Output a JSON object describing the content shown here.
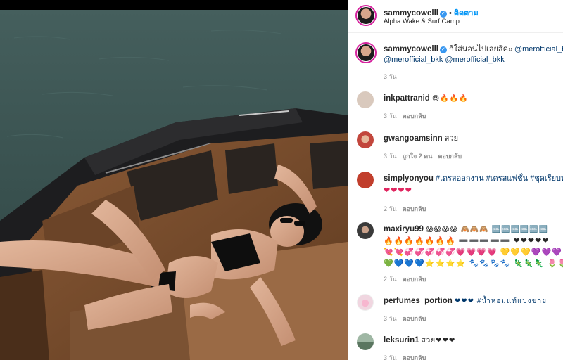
{
  "post": {
    "author": "sammycowelll",
    "follow_label": "ติดตาม",
    "dot": "•",
    "location": "Alpha Wake & Surf Camp",
    "caption_prefix": "กีใส่นอนไปเลยสิคะ",
    "caption_tags_line1": "@merofficial_bkk",
    "caption_tags_line2": "@merofficial_bkk @merofficial_bkk",
    "caption_time": "3 วัน"
  },
  "comments": [
    {
      "user": "inkpattranid",
      "text": "😍🔥🔥🔥",
      "time": "3 วัน",
      "likes": "",
      "reply": "ตอบกลับ",
      "avatar_color": "#d9c9bd"
    },
    {
      "user": "gwangoamsinn",
      "text": "สวย",
      "time": "3 วัน",
      "likes": "ถูกใจ 2 คน",
      "reply": "ตอบกลับ",
      "avatar_color": "#c2463c"
    },
    {
      "user": "simplyonyou",
      "text": "#เดรสออกงาน #เดรสแฟชั่น #ชุดเรียบหรู",
      "text2": "❤❤❤❤",
      "time": "2 วัน",
      "likes": "",
      "reply": "ตอบกลับ",
      "avatar_color": "#c13e2c"
    },
    {
      "user": "maxiryu99",
      "text": "😱😱😱😱 🙈🙈🙈 🆒🆒🆒🆒🆒🆒",
      "text2": "🔥🔥🔥🔥🔥🔥🔥 ➖➖➖➖➖ ❤❤❤❤❤",
      "text3": "💘💘💞💞💞💞💞💗💗💗💗 💛💛💛💜💜💜",
      "text4": "💚💙💙💙⭐⭐⭐⭐ 🐾🐾🐾🐾 🦎🦎🦎 🌷🌷",
      "time": "2 วัน",
      "likes": "",
      "reply": "ตอบกลับ",
      "avatar_color": "#3a3a3a"
    },
    {
      "user": "perfumes_portion",
      "text": "❤❤❤ #น้ำหอมแท้แบ่งขาย",
      "time": "3 วัน",
      "likes": "",
      "reply": "ตอบกลับ",
      "avatar_color": "#f0d6e0"
    },
    {
      "user": "leksurin1",
      "text": "สวย❤❤❤",
      "time": "3 วัน",
      "likes": "",
      "reply": "ตอบกลับ",
      "avatar_color": "#6a8a70"
    }
  ],
  "colors": {
    "link_blue": "#0095f6",
    "tag_blue": "#00376b",
    "verified": "#3897f0",
    "heart": "#e0245e",
    "meta_grey": "#8e8e8e"
  },
  "icons": {
    "verified": "verified-badge-icon"
  }
}
